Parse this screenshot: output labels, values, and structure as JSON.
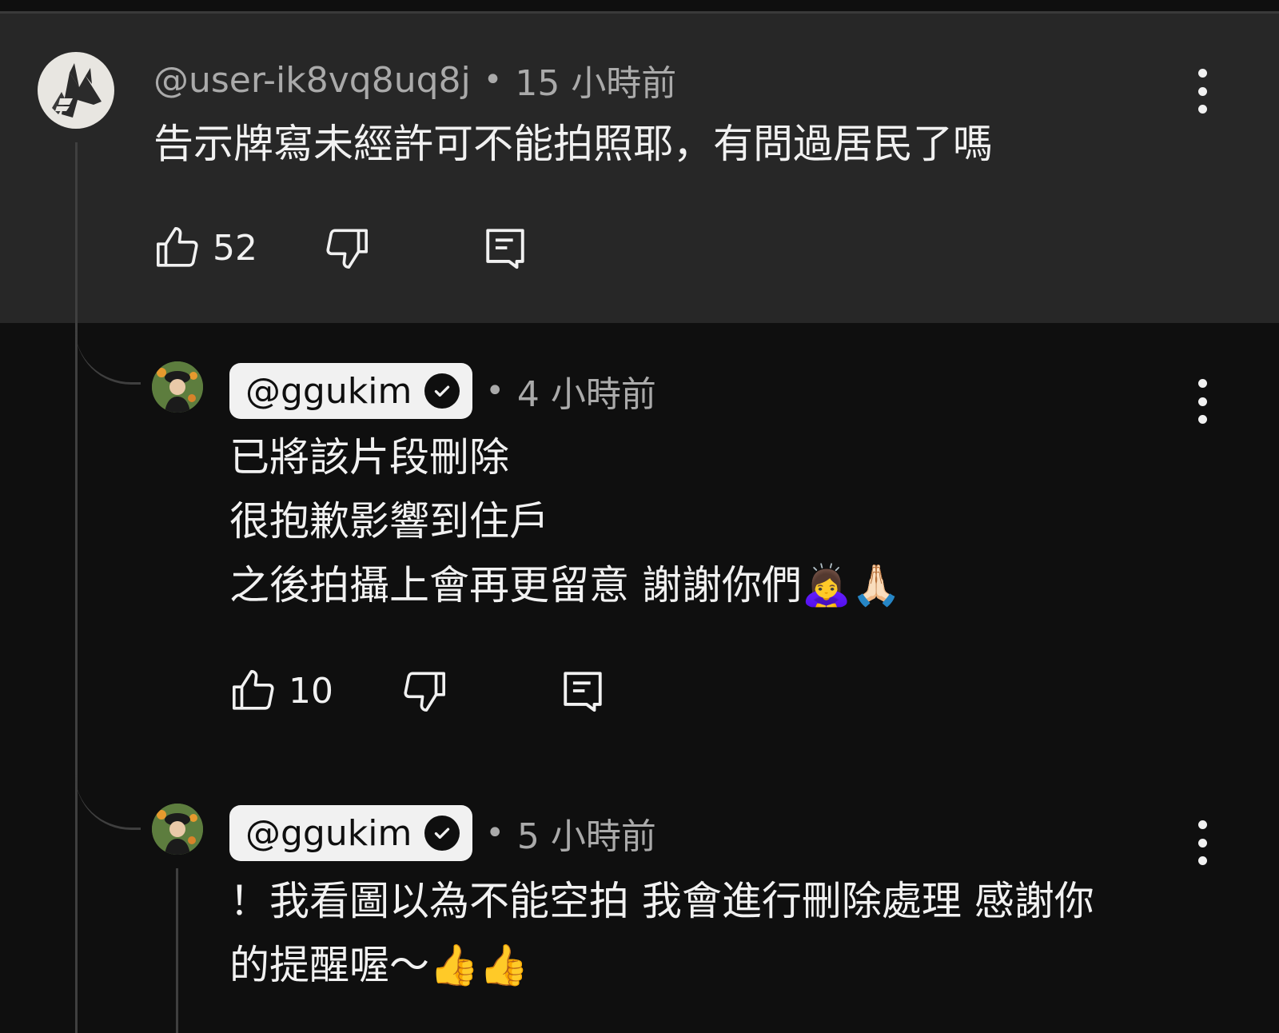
{
  "comments": [
    {
      "author": "@user-ik8vq8uq8j",
      "separator": "•",
      "time": "15 小時前",
      "lines": [
        "告示牌寫未經許可不能拍照耶，有問過居民了嗎"
      ],
      "likes": "52",
      "avatar_icon": "wolf-logo-icon"
    },
    {
      "author": "@ggukim",
      "verified": true,
      "separator": "•",
      "time": "4 小時前",
      "lines": [
        "已將該片段刪除",
        "很抱歉影響到住戶",
        "之後拍攝上會再更留意 謝謝你們🙇‍♀️🙏🏻"
      ],
      "likes": "10"
    },
    {
      "author": "@ggukim",
      "verified": true,
      "separator": "•",
      "time": "5 小時前",
      "lines": [
        "！我看圖以為不能空拍 我會進行刪除處理 感謝你",
        "的提醒喔～👍👍"
      ]
    }
  ]
}
